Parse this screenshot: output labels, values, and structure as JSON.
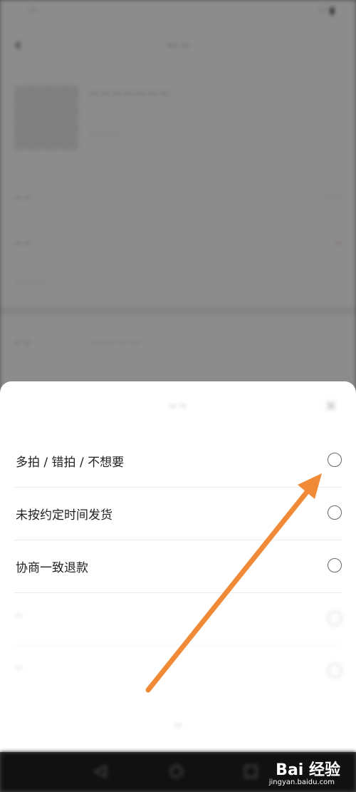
{
  "status_bar": {
    "left": "··· ",
    "right": "··· ▮"
  },
  "header": {
    "title": "··· ··"
  },
  "product": {
    "title": "··· ··· ··· ··· ··· ··· ···",
    "subtitle": "··· ··· ···"
  },
  "form": {
    "rows": [
      {
        "label": "·· ··",
        "value": "·· ··"
      },
      {
        "label": "·· ··",
        "value": "··"
      },
      {
        "label": "·· ··",
        "value": "··· ··· ··· ···"
      }
    ],
    "hint": "··· ··· ···"
  },
  "sheet": {
    "title": "·· ··",
    "close_icon": "close-icon",
    "options": [
      {
        "label": "多拍 / 错拍 / 不想要"
      },
      {
        "label": "未按约定时间发货"
      },
      {
        "label": "协商一致退款"
      },
      {
        "label": "··"
      },
      {
        "label": "··"
      }
    ],
    "cancel": "··"
  },
  "system_nav": {
    "back_icon": "back-triangle-icon",
    "home_icon": "home-circle-icon",
    "recent_icon": "recent-square-icon"
  },
  "watermark": {
    "brand": "Bai 经验",
    "url": "jingyan.baidu.com"
  },
  "colors": {
    "arrow": "#f08a36",
    "overlay": "rgba(0,0,0,0.45)",
    "accent_red": "#e6243c"
  }
}
